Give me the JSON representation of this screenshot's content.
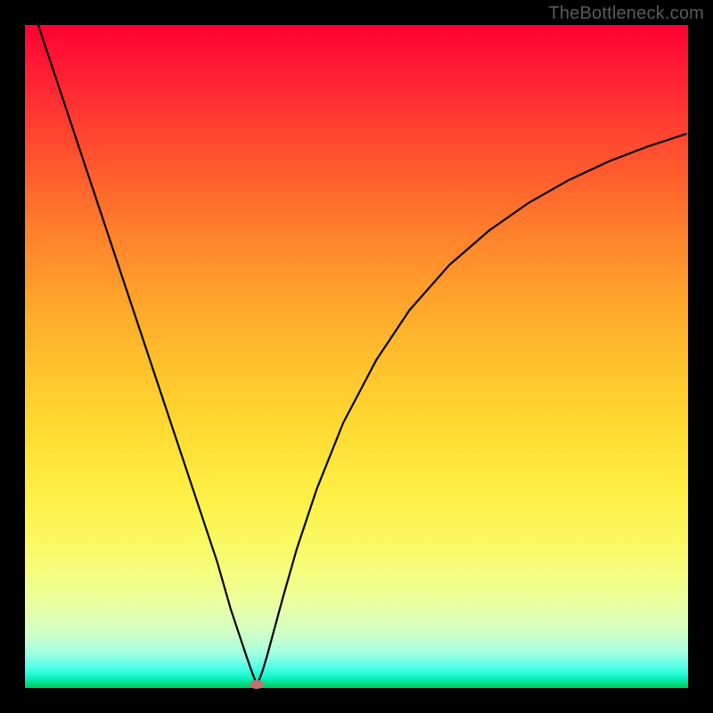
{
  "watermark": "TheBottleneck.com",
  "chart_data": {
    "type": "line",
    "title": "",
    "xlabel": "",
    "ylabel": "",
    "xlim": [
      0,
      100
    ],
    "ylim": [
      0,
      100
    ],
    "series": [
      {
        "name": "curve",
        "x": [
          2,
          5,
          8,
          11,
          14,
          17,
          20,
          23,
          26,
          29,
          31,
          32.5,
          33.5,
          34.2,
          34.7,
          35,
          35.3,
          35.8,
          36.5,
          37.5,
          39,
          41,
          44,
          48,
          53,
          58,
          64,
          70,
          76,
          82,
          88,
          94,
          99.8
        ],
        "y": [
          100,
          91,
          82,
          73,
          64,
          55,
          46,
          37,
          28,
          19,
          12,
          7.5,
          4.5,
          2.5,
          1.2,
          0.5,
          1.2,
          2.5,
          4.8,
          8.5,
          14,
          21,
          30,
          40,
          49.5,
          57,
          63.8,
          69,
          73.2,
          76.6,
          79.4,
          81.7,
          83.6
        ]
      }
    ],
    "marker": {
      "x": 35,
      "y": 0.5
    },
    "gradient_stops": [
      {
        "pos": 0,
        "color": "#ff0033"
      },
      {
        "pos": 50,
        "color": "#ffc12d"
      },
      {
        "pos": 82,
        "color": "#f6fd7a"
      },
      {
        "pos": 100,
        "color": "#00c95b"
      }
    ]
  }
}
